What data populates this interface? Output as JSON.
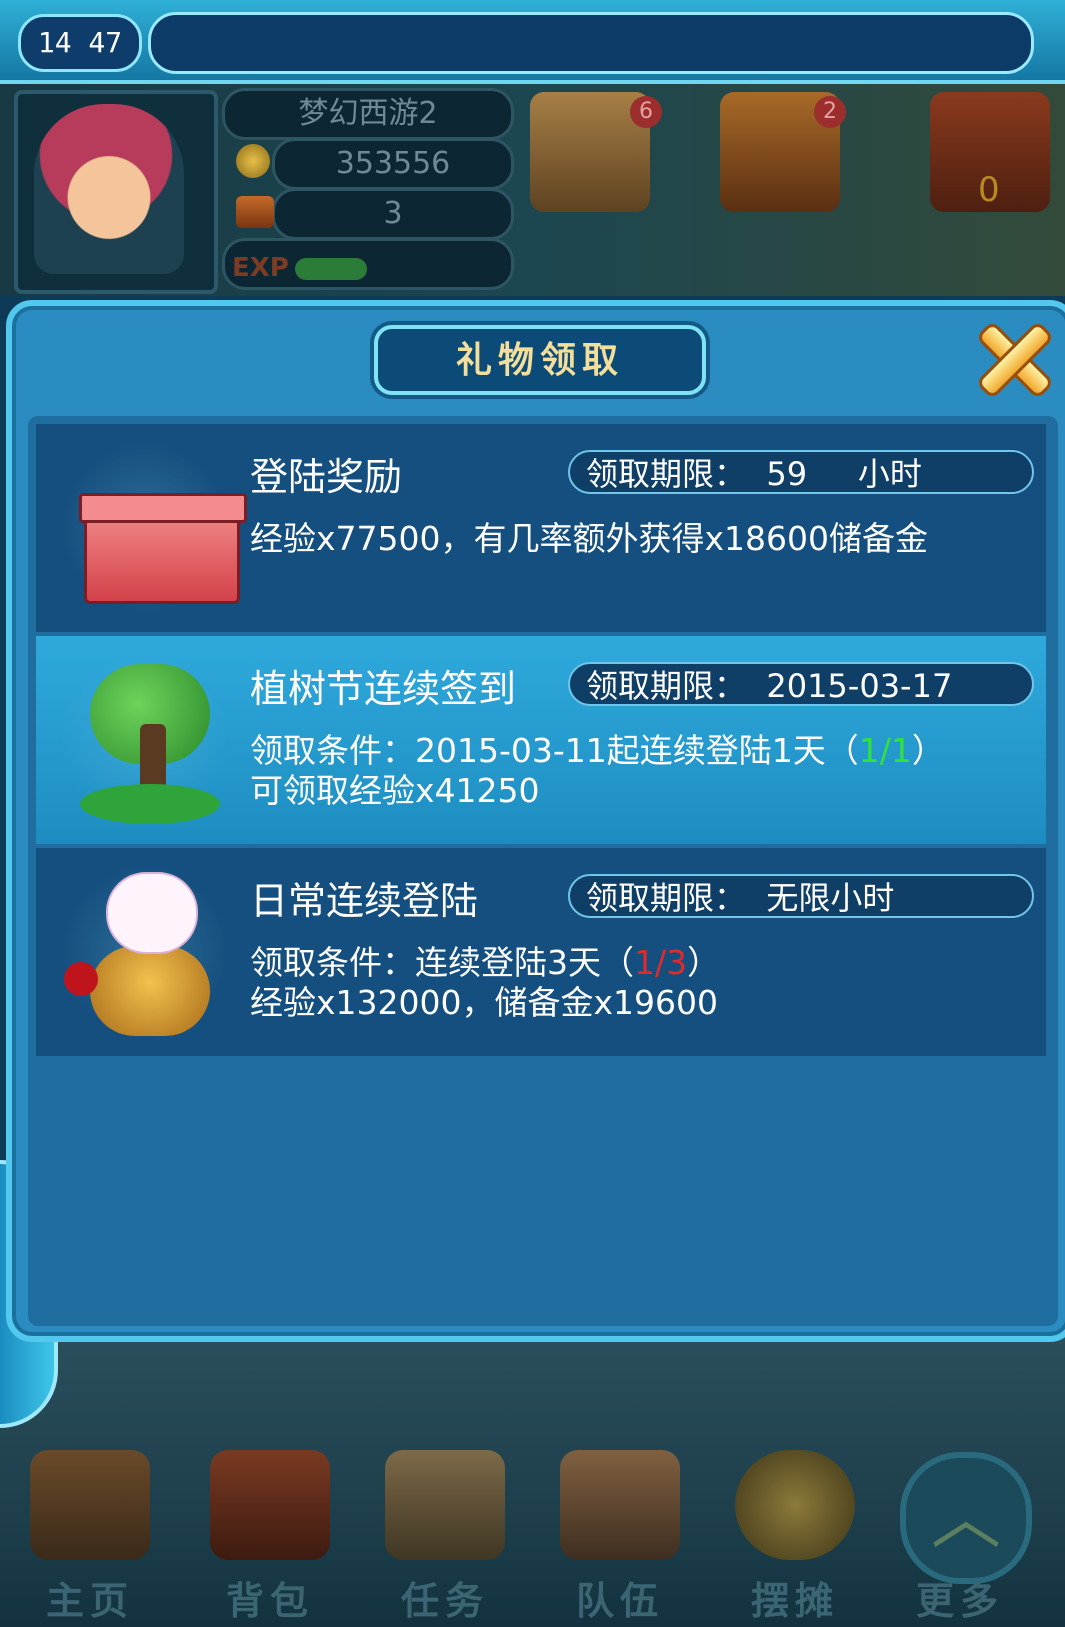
{
  "status_bar": {
    "time": "14 47"
  },
  "player": {
    "name": "梦幻西游2",
    "gold": "353556",
    "chests": "3",
    "exp_label": "EXP",
    "exp_fraction": 0.36
  },
  "hud_icons": [
    {
      "name": "scroll",
      "badge": "6"
    },
    {
      "name": "treasure-chest",
      "badge": "2"
    },
    {
      "name": "fire-scroll",
      "badge": "0"
    }
  ],
  "dialog": {
    "title": "礼物领取",
    "rewards": [
      {
        "title": "登陆奖励",
        "limit": "领取期限：  59     小时",
        "line1": "经验x77500，有几率额外获得x18600储备金",
        "line2": "",
        "icon": "red-box-icon",
        "highlighted": false
      },
      {
        "title": "植树节连续签到",
        "limit": "领取期限：  2015-03-17",
        "line1_prefix": "领取条件：2015-03-11起连续登陆1天（",
        "line1_progress": "1/1",
        "line1_suffix": "）",
        "line2": "可领取经验x41250",
        "icon": "tree-icon",
        "highlighted": true
      },
      {
        "title": "日常连续登陆",
        "limit": "领取期限：  无限小时",
        "line1_prefix": "领取条件：连续登陆3天（",
        "line1_progress": "1/3",
        "line1_suffix": "）",
        "line2": "经验x132000，储备金x19600",
        "icon": "lucky-cat-pot-icon",
        "highlighted": false
      }
    ]
  },
  "bottom_nav": [
    {
      "label": "主页",
      "icon": "pagoda-icon"
    },
    {
      "label": "背包",
      "icon": "backpack-chest-icon"
    },
    {
      "label": "任务",
      "icon": "quest-scroll-icon"
    },
    {
      "label": "队伍",
      "icon": "team-icon"
    },
    {
      "label": "摆摊",
      "icon": "coin-stall-icon"
    },
    {
      "label": "更多",
      "icon": "chevron-up-icon"
    }
  ],
  "colors": {
    "progress_complete": "#2fe33b",
    "progress_incomplete": "#e12a2a",
    "dialog_bg": "#2a8cc0"
  }
}
